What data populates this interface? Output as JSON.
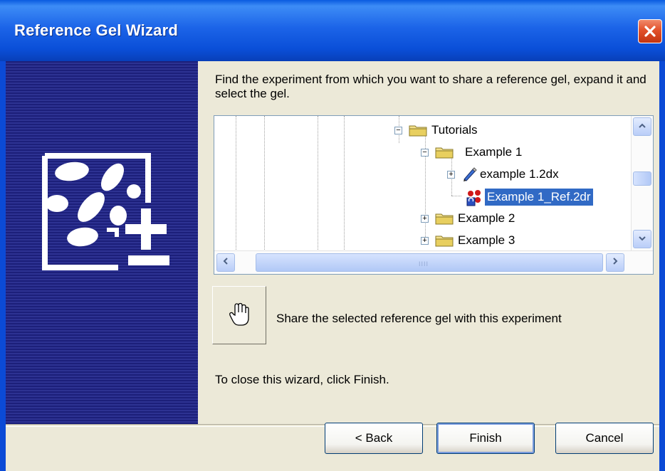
{
  "window": {
    "title": "Reference Gel Wizard",
    "close_icon": "close-icon"
  },
  "instruction": "Find the experiment from which you want to share a reference gel, expand it and select the gel.",
  "tree": {
    "nodes": [
      {
        "label": "Tutorials",
        "expander": "−",
        "icon": "folder-icon",
        "level": 0
      },
      {
        "label": "Example 1",
        "expander": "−",
        "icon": "folder-icon",
        "level": 1
      },
      {
        "label": "example 1.2dx",
        "expander": "+",
        "icon": "pen-icon",
        "level": 2
      },
      {
        "label": "Example 1_Ref.2dr",
        "expander": "",
        "icon": "reference-gel-icon",
        "level": 2,
        "selected": true
      },
      {
        "label": "Example 2",
        "expander": "+",
        "icon": "folder-icon",
        "level": 1
      },
      {
        "label": "Example 3",
        "expander": "+",
        "icon": "folder-icon",
        "level": 1
      }
    ]
  },
  "share": {
    "icon": "hand-pointer-icon",
    "label": "Share the selected reference gel with this experiment"
  },
  "close_hint": "To close this wizard, click Finish.",
  "buttons": {
    "back": "< Back",
    "finish": "Finish",
    "cancel": "Cancel"
  },
  "colors": {
    "title_bar": "#0a5be0",
    "side_panel": "#1c1f7a",
    "selection": "#316ac5",
    "dialog_bg": "#ece9d8"
  }
}
